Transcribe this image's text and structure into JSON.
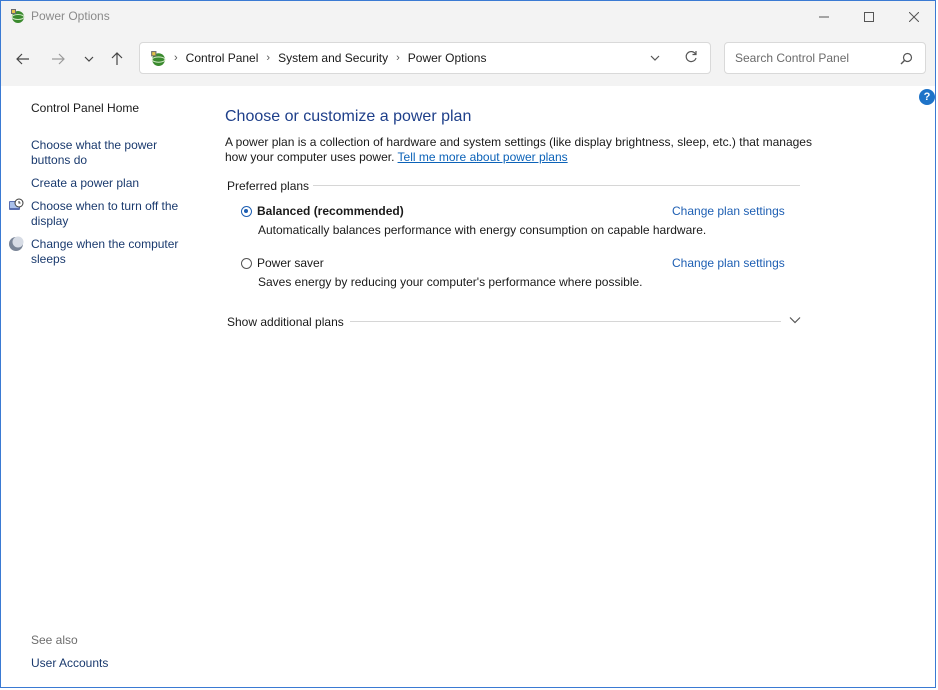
{
  "window": {
    "title": "Power Options"
  },
  "address": {
    "crumbs": [
      "Control Panel",
      "System and Security",
      "Power Options"
    ]
  },
  "search": {
    "placeholder": "Search Control Panel"
  },
  "sidebar": {
    "home": "Control Panel Home",
    "links": [
      "Choose what the power buttons do",
      "Create a power plan",
      "Choose when to turn off the display",
      "Change when the computer sleeps"
    ],
    "see_also_label": "See also",
    "see_also_links": [
      "User Accounts"
    ]
  },
  "main": {
    "title": "Choose or customize a power plan",
    "description": "A power plan is a collection of hardware and system settings (like display brightness, sleep, etc.) that manages how your computer uses power.",
    "learn_more_link": "Tell me more about power plans",
    "group_label": "Preferred plans",
    "plans": [
      {
        "name": "Balanced (recommended)",
        "description": "Automatically balances performance with energy consumption on capable hardware.",
        "link": "Change plan settings",
        "selected": true
      },
      {
        "name": "Power saver",
        "description": "Saves energy by reducing your computer's performance where possible.",
        "link": "Change plan settings",
        "selected": false
      }
    ],
    "show_more": "Show additional plans"
  },
  "help": {
    "label": "?"
  },
  "colors": {
    "accent": "#1e5fb3",
    "link": "#1a3a6e",
    "title": "#1e3f8a"
  }
}
